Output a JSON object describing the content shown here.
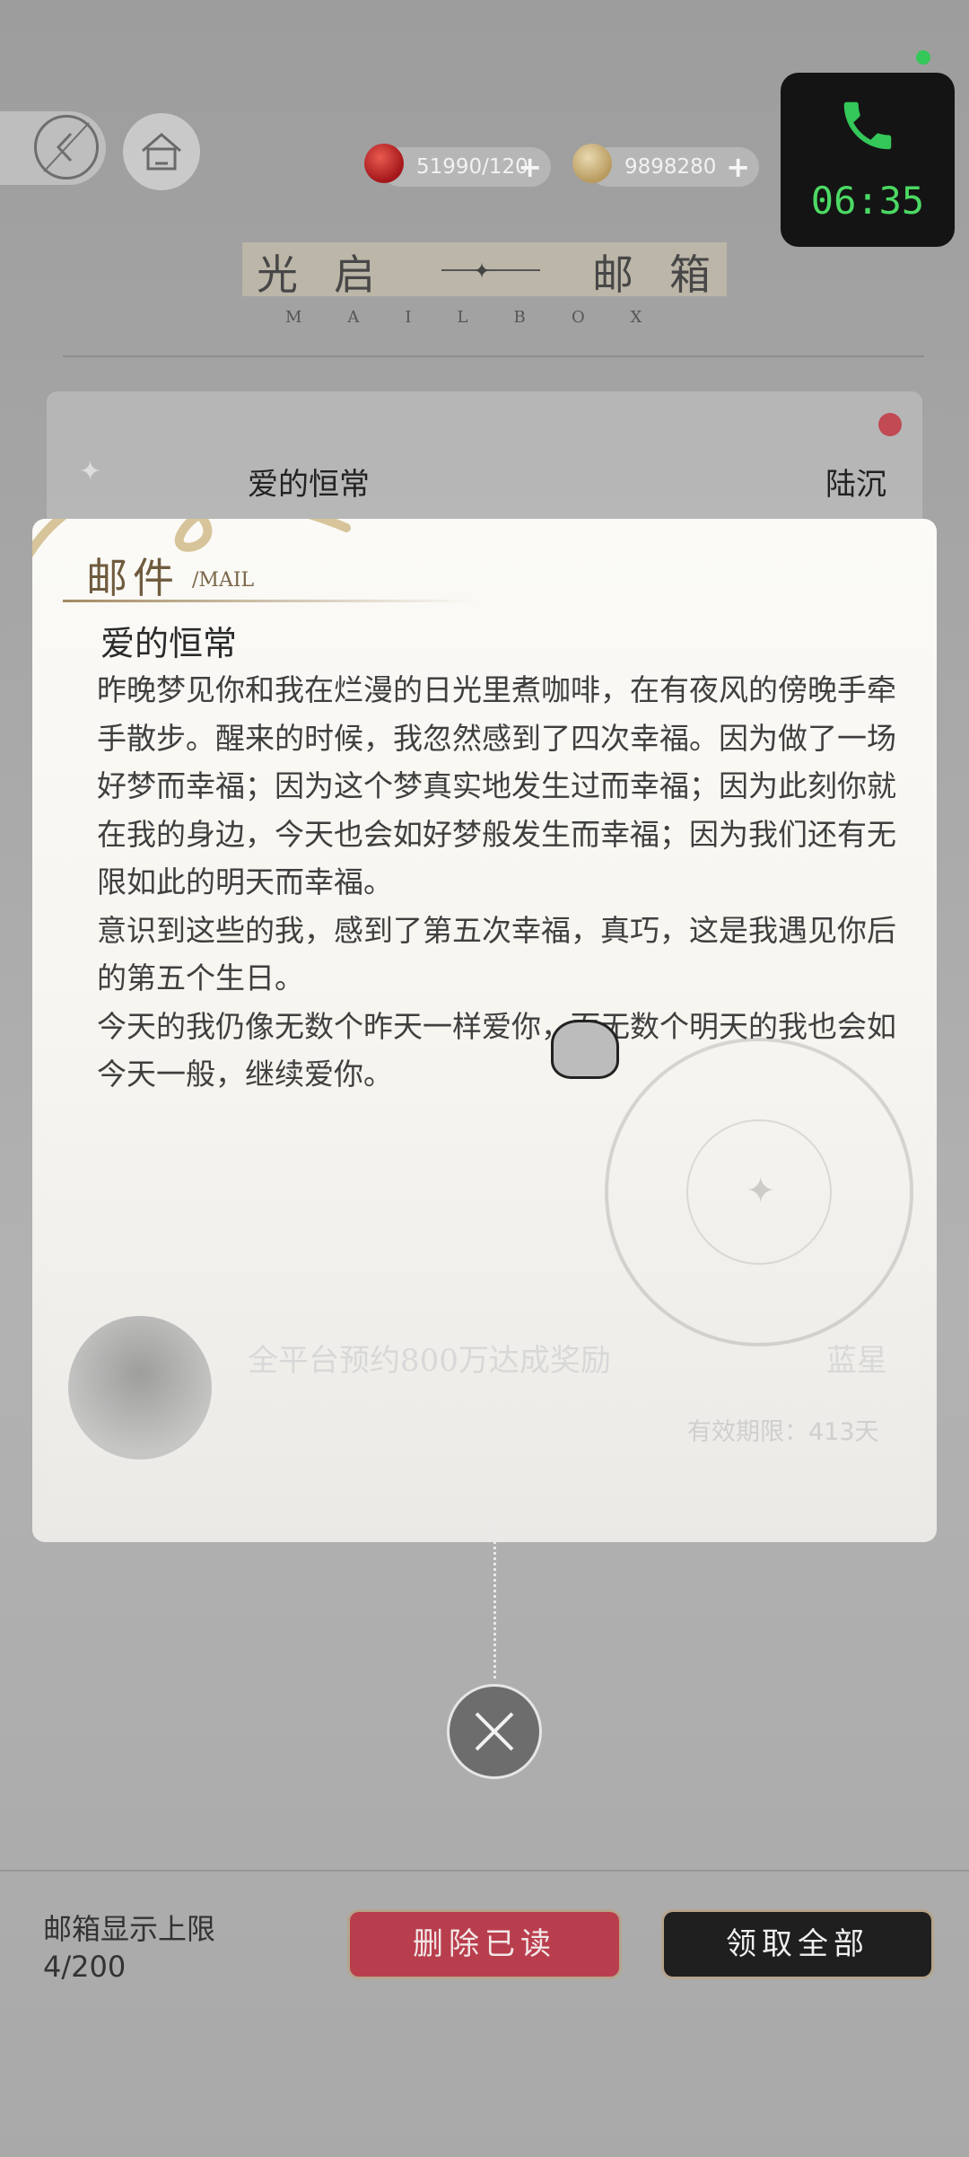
{
  "top_bar": {
    "resources": [
      {
        "icon": "apple-icon",
        "value": "51990/120"
      },
      {
        "icon": "coin-icon",
        "value": "9898280"
      }
    ]
  },
  "call": {
    "timer": "06:35",
    "accent": "#34c759"
  },
  "header": {
    "title_left": "光启",
    "title_right": "邮箱",
    "subtitle": "MAILBOX"
  },
  "list": {
    "items": [
      {
        "title": "爱的恒常",
        "sender": "陆沉"
      },
      {
        "title": "全平台预约800万达成奖励",
        "sender": "蓝星",
        "expiry": "有效期限：413天"
      }
    ]
  },
  "popup": {
    "header_cn": "邮件",
    "header_en": "/MAIL",
    "subject": "爱的恒常",
    "body": [
      "昨晚梦见你和我在烂漫的日光里煮咖啡，在有夜风的傍晚手牵手散步。醒来的时候，我忽然感到了四次幸福。因为做了一场好梦而幸福；因为这个梦真实地发生过而幸福；因为此刻你就在我的身边，今天也会如好梦般发生而幸福；因为我们还有无限如此的明天而幸福。",
      "意识到这些的我，感到了第五次幸福，真巧，这是我遇见你后的第五个生日。",
      "今天的我仍像无数个昨天一样爱你，而无数个明天的我也会如今天一般，继续爱你。"
    ]
  },
  "bottom": {
    "limit_label": "邮箱显示上限",
    "limit_value": "4/200",
    "delete_label": "删除已读",
    "claim_label": "领取全部",
    "delete_color": "#b93e4d",
    "claim_color": "#1f1f1f"
  }
}
